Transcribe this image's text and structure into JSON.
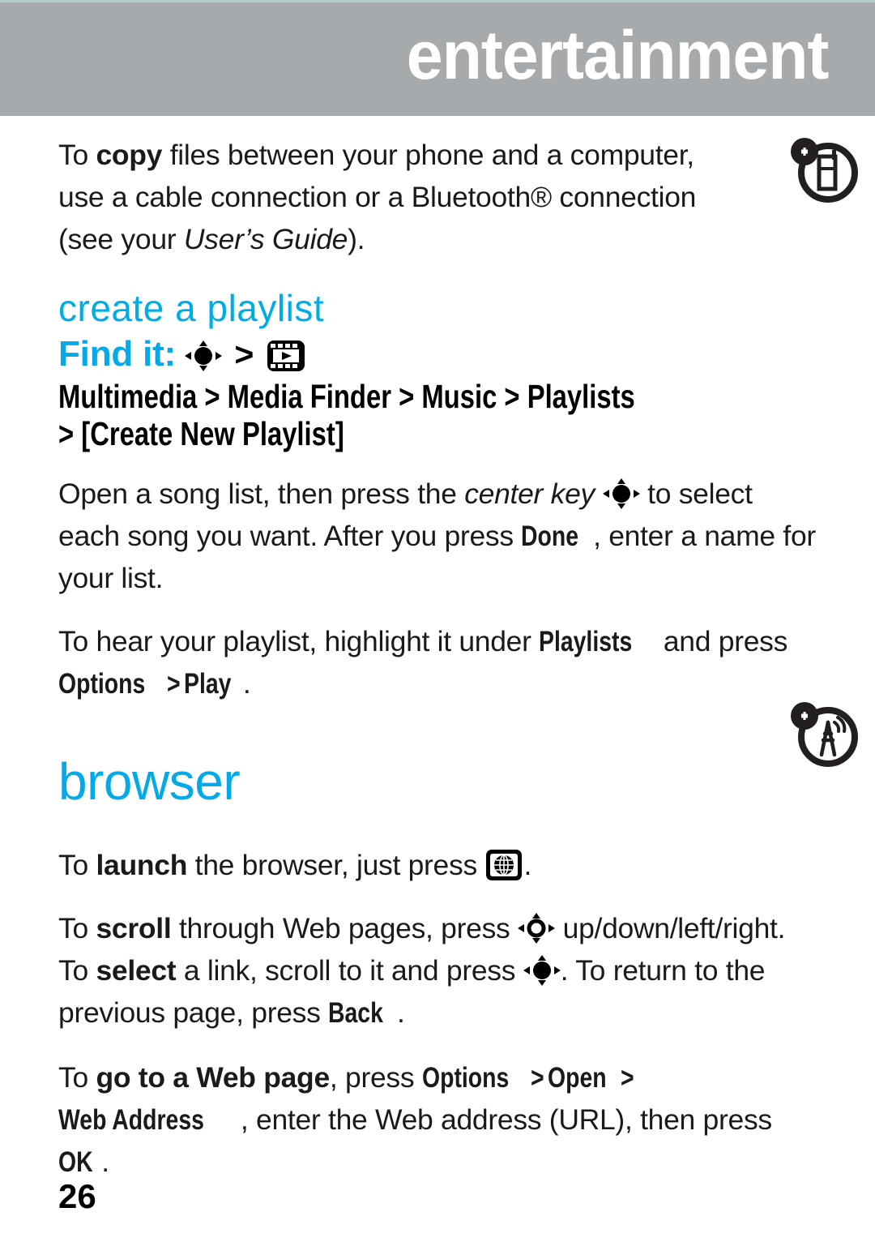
{
  "header": {
    "title": "entertainment",
    "banner_color": "#a7aaad",
    "title_color": "#ffffff",
    "top_rule_color": "#b6cdce"
  },
  "accent_color": "#03a9e8",
  "paragraphs": {
    "copy": {
      "p1": "To ",
      "bold1": "copy",
      "p2": " files between your phone and a computer, use a cable connection or a Bluetooth® connection (see your ",
      "italic1": "User’s Guide",
      "p3": ")."
    },
    "open_song": {
      "p1": "Open a song list, then press the ",
      "italic1": "center key",
      "p2": " ",
      "p3": " to select each song you want. After you press ",
      "menu1": "Done",
      "p4": ", enter a name for your list."
    },
    "hear": {
      "p1": "To hear your playlist, highlight it under ",
      "menu1": "Playlists",
      "p2": " and press ",
      "menu2": "Options",
      "gt": " > ",
      "menu3": "Play",
      "p3": "."
    },
    "launch": {
      "p1": "To ",
      "bold1": "launch",
      "p2": " the browser, just press ",
      "p3": "."
    },
    "scroll": {
      "p1": "To ",
      "bold1": "scroll",
      "p2": " through Web pages, press ",
      "p3": " up/down/left/right. To ",
      "bold2": "select",
      "p4": " a link, scroll to it and press ",
      "p5": ". To return to the previous page, press ",
      "menu1": "Back",
      "p6": "."
    },
    "goto": {
      "p1": "To ",
      "bold1": "go to a Web page",
      "p2": ", press ",
      "menu1": "Options",
      "gt1": " > ",
      "menu2": "Open",
      "gt2": " > ",
      "menu3": "Web Address",
      "p3": ", enter the Web address (URL), then press ",
      "menu4": "OK",
      "p4": "."
    }
  },
  "sections": {
    "create_playlist": {
      "heading": "create a playlist",
      "find_it_label": "Find it:",
      "path": [
        {
          "type": "icon",
          "icon": "center-key-icon"
        },
        {
          "type": "sep",
          "text": ">"
        },
        {
          "type": "icon",
          "icon": "multimedia-film-icon"
        },
        {
          "type": "item",
          "text": "Multimedia"
        },
        {
          "type": "sep",
          "text": ">"
        },
        {
          "type": "item",
          "text": "Media Finder"
        },
        {
          "type": "sep",
          "text": ">"
        },
        {
          "type": "item",
          "text": "Music"
        },
        {
          "type": "sep",
          "text": ">"
        },
        {
          "type": "item",
          "text": "Playlists"
        },
        {
          "type": "sep",
          "text": ">"
        },
        {
          "type": "item",
          "text": "[Create New Playlist]"
        }
      ],
      "path_line1": "Multimedia > Media Finder > Music > Playlists",
      "path_line2": "> [Create New Playlist]"
    },
    "browser": {
      "heading": "browser"
    }
  },
  "icons": {
    "phone_transfer": "phone-transfer-feature-icon",
    "browser_antenna": "browser-antenna-feature-icon",
    "center_key": "center-key-icon",
    "scroll_key": "scroll-key-icon",
    "film": "multimedia-film-icon",
    "globe_key": "browser-globe-key-icon"
  },
  "footer": {
    "page_number": "26"
  }
}
